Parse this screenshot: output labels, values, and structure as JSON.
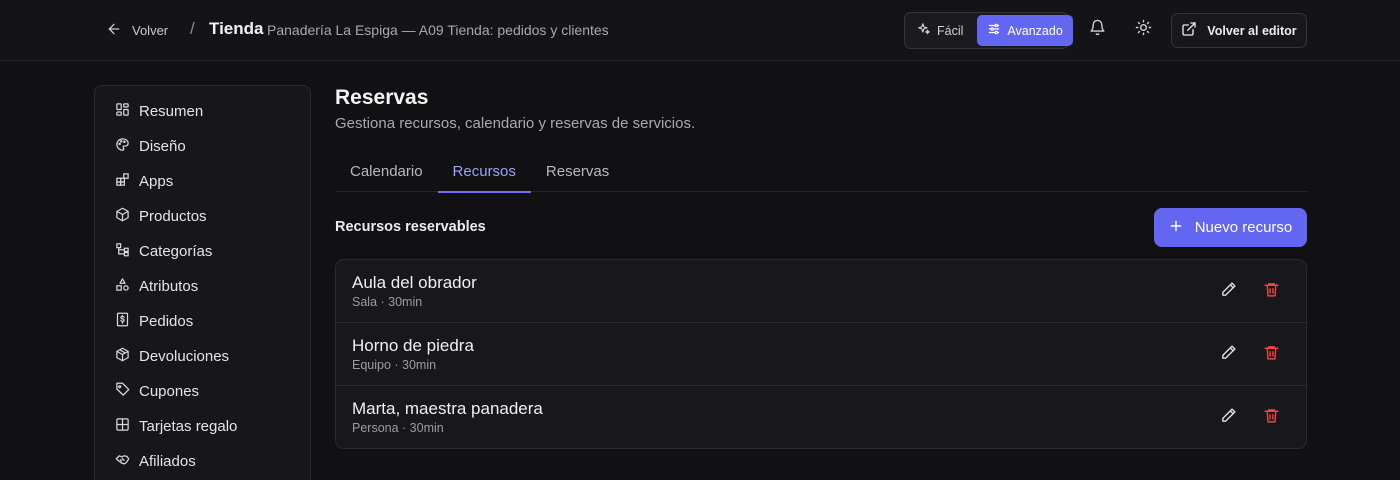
{
  "header": {
    "back_label": "Volver",
    "separator": "/",
    "title": "Tienda",
    "subtitle": "Panadería La Espiga — A09 Tienda: pedidos y clientes",
    "mode_easy": "Fácil",
    "mode_advanced": "Avanzado",
    "active_mode": "Avanzado",
    "editor_label": "Volver al editor"
  },
  "sidebar": {
    "items": [
      {
        "label": "Resumen",
        "icon": "dashboard-icon"
      },
      {
        "label": "Diseño",
        "icon": "palette-icon"
      },
      {
        "label": "Apps",
        "icon": "apps-icon"
      },
      {
        "label": "Productos",
        "icon": "package-icon"
      },
      {
        "label": "Categorías",
        "icon": "hierarchy-icon"
      },
      {
        "label": "Atributos",
        "icon": "shapes-icon"
      },
      {
        "label": "Pedidos",
        "icon": "receipt-dollar-icon"
      },
      {
        "label": "Devoluciones",
        "icon": "package-return-icon"
      },
      {
        "label": "Cupones",
        "icon": "tag-icon"
      },
      {
        "label": "Tarjetas regalo",
        "icon": "gift-card-icon"
      },
      {
        "label": "Afiliados",
        "icon": "handshake-icon"
      }
    ]
  },
  "main": {
    "title": "Reservas",
    "subtitle": "Gestiona recursos, calendario y reservas de servicios.",
    "tabs": [
      {
        "label": "Calendario"
      },
      {
        "label": "Recursos"
      },
      {
        "label": "Reservas"
      }
    ],
    "active_tab": "Recursos",
    "section_title": "Recursos reservables",
    "new_button": "Nuevo recurso",
    "resources": [
      {
        "name": "Aula del obrador",
        "meta": "Sala · 30min"
      },
      {
        "name": "Horno de piedra",
        "meta": "Equipo · 30min"
      },
      {
        "name": "Marta, maestra panadera",
        "meta": "Persona · 30min"
      }
    ]
  },
  "colors": {
    "background": "#111114",
    "accent": "#6366f1",
    "danger": "#ef4444"
  }
}
